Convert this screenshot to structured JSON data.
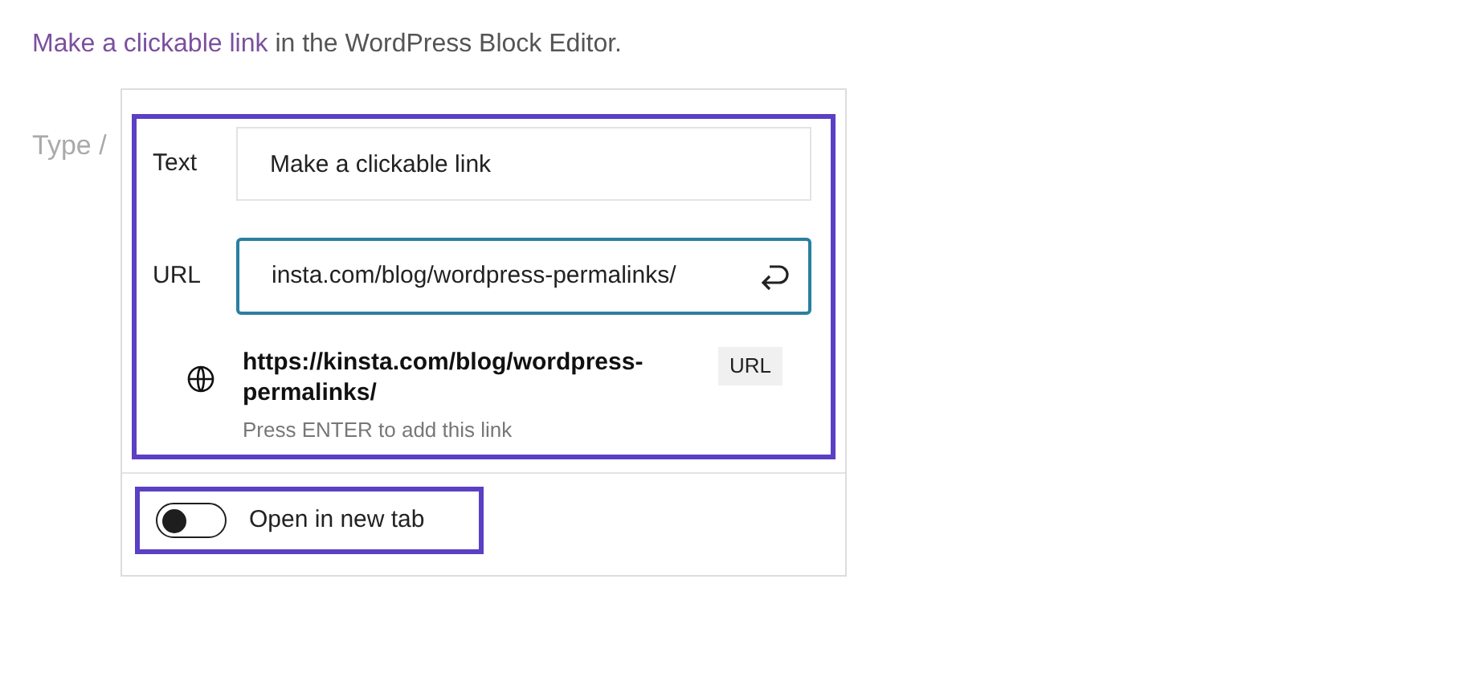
{
  "caption": {
    "link": "Make a clickable link",
    "text": "in the WordPress Block Editor."
  },
  "editor_placeholder": "Type /",
  "link_popover": {
    "text_label": "Text",
    "text_value": "Make a clickable link",
    "url_label": "URL",
    "url_value": "insta.com/blog/wordpress-permalinks/",
    "suggestion": {
      "url": "https://kinsta.com/blog/wordpress-permalinks/",
      "badge": "URL",
      "hint": "Press ENTER to add this link"
    },
    "new_tab_toggle": {
      "label": "Open in new tab",
      "on": false
    }
  }
}
